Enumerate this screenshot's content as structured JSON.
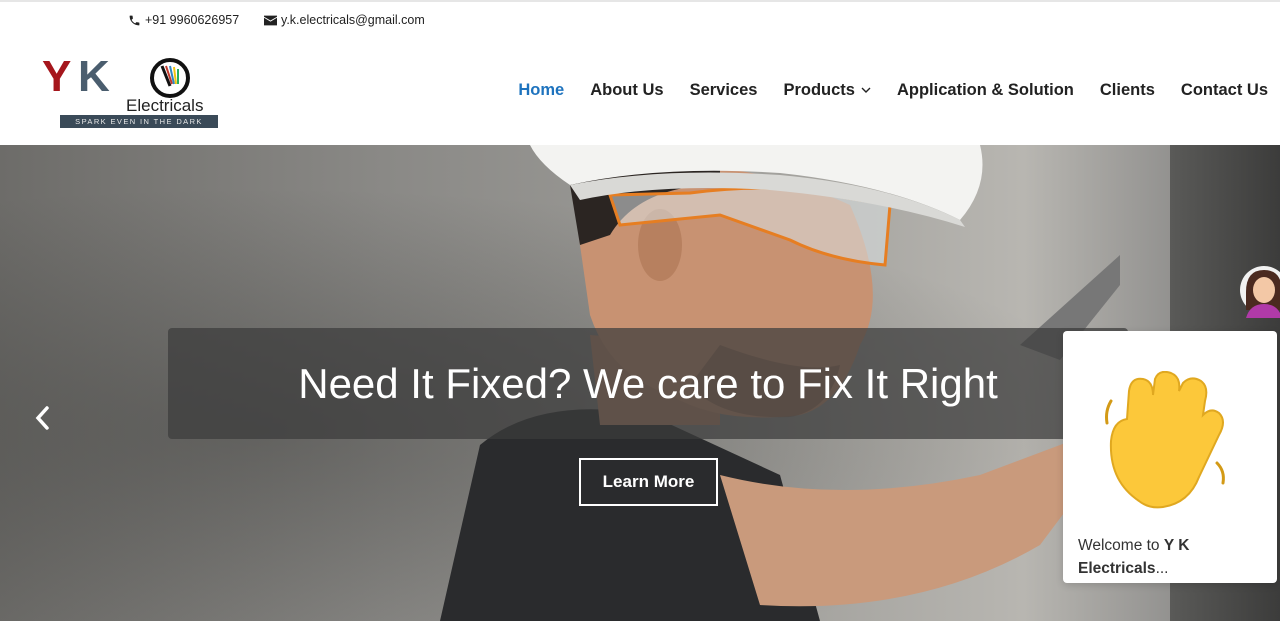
{
  "topbar": {
    "phone": "+91 9960626957",
    "email": "y.k.electricals@gmail.com",
    "phone_icon": "phone-icon",
    "email_icon": "envelope-icon"
  },
  "logo": {
    "letter_y": "Y",
    "letter_k": "K",
    "word": "Electricals",
    "tagline": "SPARK EVEN IN THE DARK"
  },
  "nav": {
    "items": [
      {
        "label": "Home",
        "active": true
      },
      {
        "label": "About Us"
      },
      {
        "label": "Services"
      },
      {
        "label": "Products",
        "has_dropdown": true
      },
      {
        "label": "Application & Solution"
      },
      {
        "label": "Clients"
      },
      {
        "label": "Contact Us"
      }
    ]
  },
  "hero": {
    "headline": "Need It Fixed? We care to Fix It Right",
    "cta_label": "Learn More",
    "prev_icon": "chevron-left-icon"
  },
  "chat": {
    "welcome_prefix": "Welcome to ",
    "welcome_bold": "Y K Electricals",
    "welcome_suffix": "...",
    "icon": "waving-hand-icon"
  },
  "colors": {
    "accent": "#1e73be",
    "logo_red": "#a5161c",
    "logo_slate": "#4a5d6e"
  }
}
